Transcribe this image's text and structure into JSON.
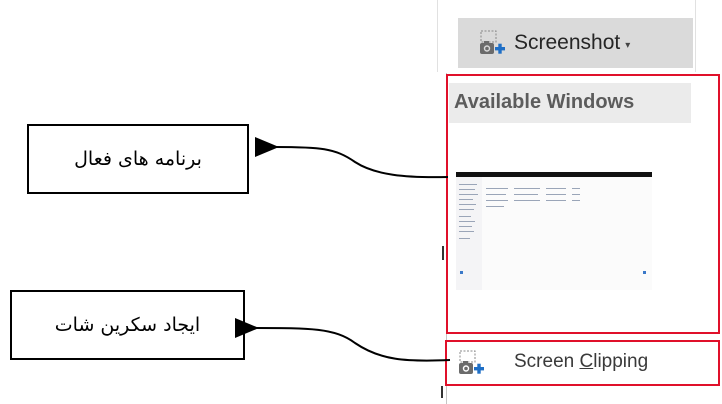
{
  "ribbon": {
    "screenshot_label": "Screenshot",
    "screenshot_caret": "▾",
    "screenshot_icon": "camera-plus-icon"
  },
  "dropdown": {
    "section_header": "Available Windows",
    "screen_clipping_prefix": "Screen ",
    "screen_clipping_accel": "C",
    "screen_clipping_suffix": "lipping",
    "screen_clipping_icon": "camera-plus-icon"
  },
  "callouts": {
    "active_programs": "برنامه های فعال",
    "create_screenshot": "ایجاد سکرین شات"
  },
  "colors": {
    "highlight_border": "#e0102a",
    "button_bg": "#dadada",
    "header_bg": "#ebebeb",
    "accent_blue": "#1f6fc6"
  }
}
